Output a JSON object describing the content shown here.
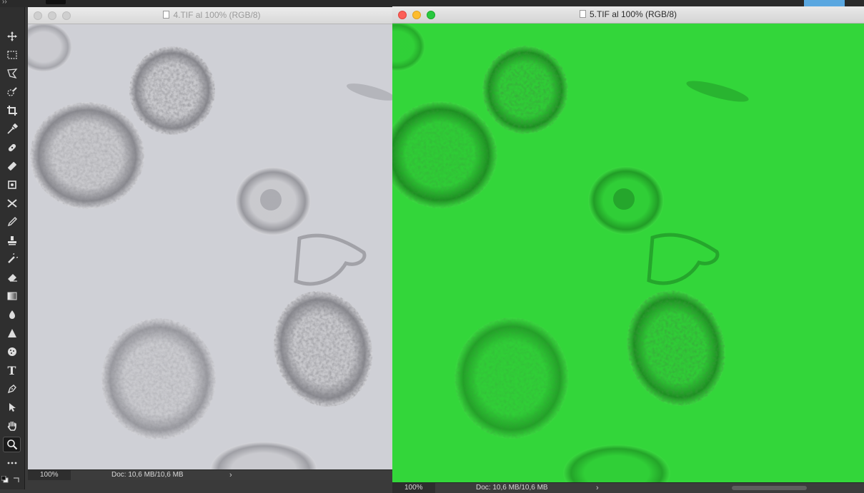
{
  "windows": [
    {
      "title": "4.TIF al 100% (RGB/8)",
      "zoom": "100%",
      "doc_info": "Doc: 10,6 MB/10,6 MB",
      "active": false
    },
    {
      "title": "5.TIF al 100% (RGB/8)",
      "zoom": "100%",
      "doc_info": "Doc: 10,6 MB/10,6 MB",
      "active": true
    }
  ],
  "tools": [
    "move-icon",
    "marquee-icon",
    "lasso-icon",
    "quick-select-icon",
    "crop-icon",
    "eyedropper-icon",
    "healing-icon",
    "brush-icon",
    "patch-icon",
    "content-aware-move-icon",
    "pencil-icon",
    "stamp-icon",
    "history-brush-icon",
    "eraser-icon",
    "gradient-icon",
    "blur-icon",
    "sharpen-icon",
    "sponge-icon",
    "type-icon",
    "pen-icon",
    "path-select-icon",
    "hand-icon",
    "zoom-icon",
    "more-icon"
  ],
  "type_tool_glyph": "T",
  "colors": {
    "canvas_grey": "#cfd0d6",
    "canvas_green": "#33d63a",
    "panel": "#2f2f2f"
  }
}
